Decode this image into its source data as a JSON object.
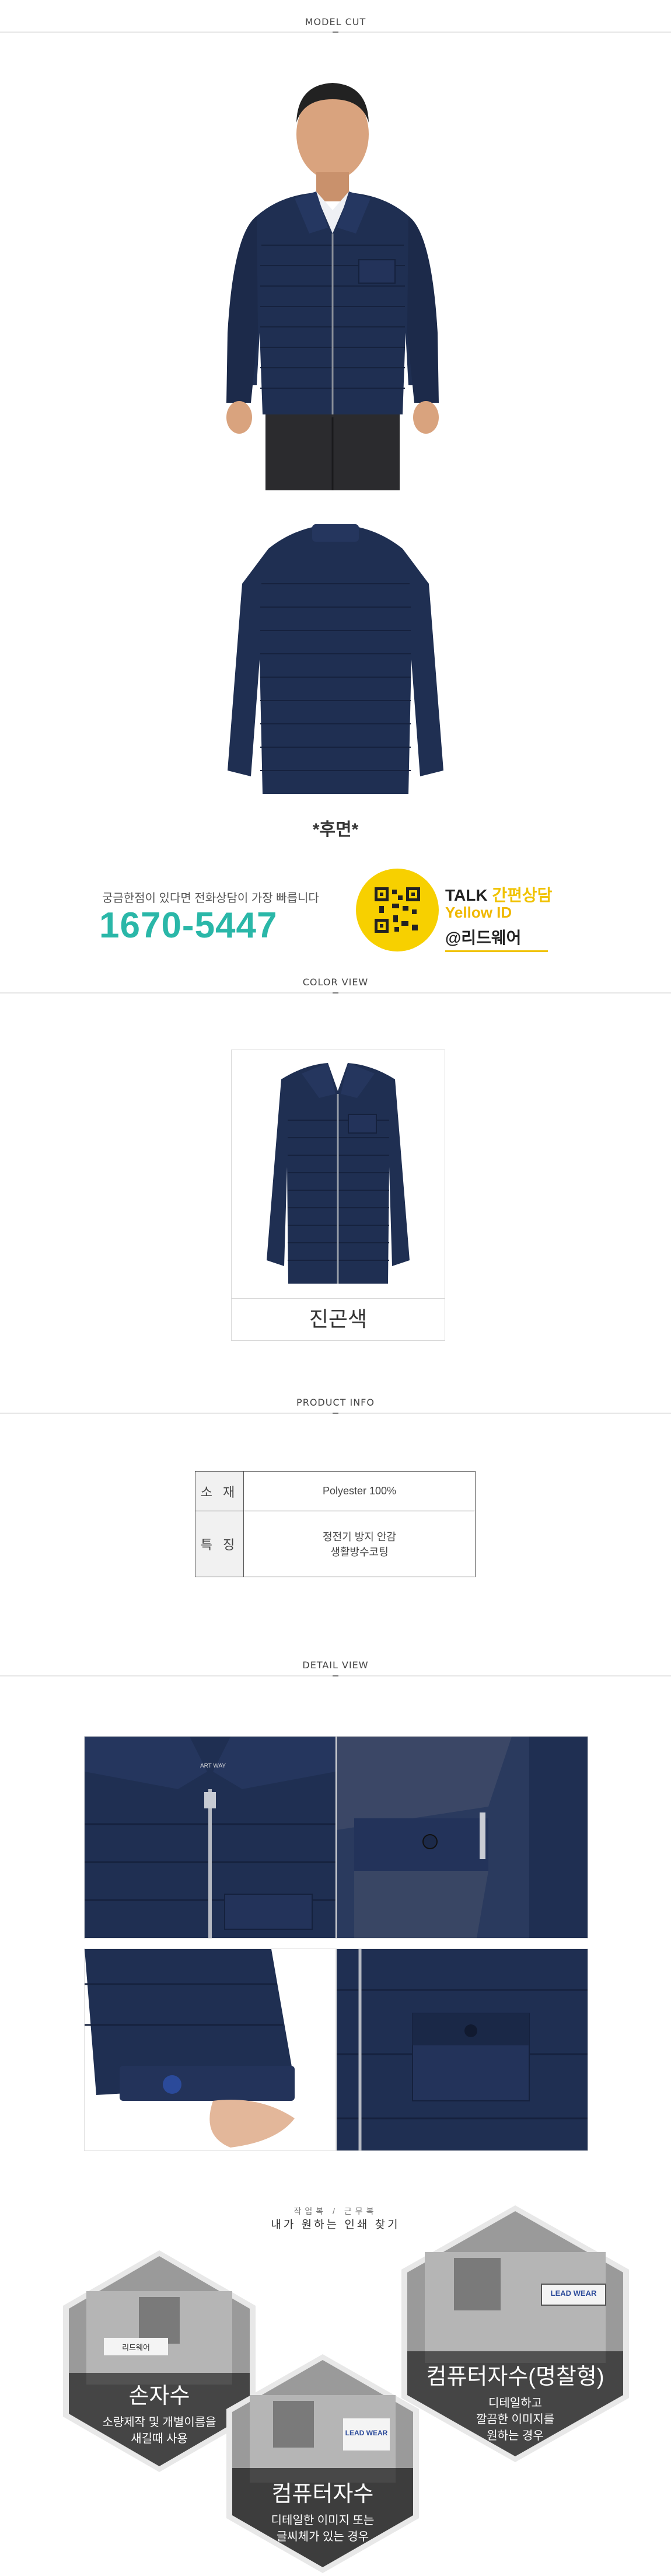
{
  "sections": {
    "model_cut": "MODEL CUT",
    "color_view": "COLOR VIEW",
    "product_info": "PRODUCT INFO",
    "detail_view": "DETAIL VIEW"
  },
  "back_caption": "*후면*",
  "contact": {
    "caption": "궁금한점이 있다면 전화상담이 가장 빠릅니다",
    "phone": "1670-5447",
    "talk_title_en": "TALK",
    "talk_title_ko": "간편상담",
    "yellow_id": "Yellow ID",
    "kakao_id": "@리드웨어"
  },
  "color": {
    "name": "진곤색",
    "swatch": "#1f2f52"
  },
  "product_info": {
    "rows": [
      {
        "label": "소 재",
        "value": "Polyester 100%"
      },
      {
        "label": "특 징",
        "value_line1": "정전기 방지 안감",
        "value_line2": "생활방수코팅"
      }
    ]
  },
  "detail": {
    "brand_tag": "ART WAY"
  },
  "print_options": {
    "subtitle": "작업복 / 근무복",
    "title": "내가 원하는 인쇄 찾기",
    "items": [
      {
        "title": "손자수",
        "desc_line1": "소량제작 및 개별이름을",
        "desc_line2": "새길때 사용",
        "patch": "리드웨어"
      },
      {
        "title": "컴퓨터자수",
        "desc_line1": "디테일한 이미지 또는",
        "desc_line2": "글씨체가 있는 경우",
        "patch": "LEAD WEAR"
      },
      {
        "title": "컴퓨터자수(명찰형)",
        "desc_line1": "디테일하고",
        "desc_line2": "깔끔한 이미지를",
        "desc_line3": "원하는 경우",
        "patch": "LEAD WEAR"
      }
    ]
  },
  "colors": {
    "navy": "#1f2f52",
    "teal": "#2ab7a8",
    "kakao": "#f7d000"
  }
}
